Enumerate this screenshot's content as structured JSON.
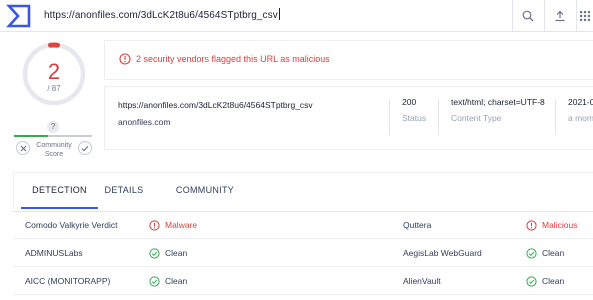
{
  "topbar": {
    "url_value": "https://anonfiles.com/3dLcK2t8u6/4564STptbrg_csv",
    "logo_icon": "virustotal-sigma-logo",
    "search_icon": "search-icon",
    "upload_icon": "upload-icon",
    "apps_icon": "apps-grid-icon"
  },
  "score": {
    "detections": "2",
    "total": "/ 87",
    "community_unknown": "?",
    "community_label": "Community Score"
  },
  "alert": {
    "text": "2 security vendors flagged this URL as malicious",
    "color": "#d93e3e"
  },
  "info": {
    "url": "https://anonfiles.com/3dLcK2t8u6/4564STptbrg_csv",
    "host": "anonfiles.com",
    "status_value": "200",
    "status_label": "Status",
    "content_type_value": "text/html; charset=UTF-8",
    "content_type_label": "Content Type",
    "date_value": "2021-0",
    "date_label": "a mom"
  },
  "tabs": [
    {
      "label": "DETECTION"
    },
    {
      "label": "DETAILS"
    },
    {
      "label": "COMMUNITY"
    }
  ],
  "detections": [
    {
      "vendor_left": "Comodo Valkyrie Verdict",
      "verdict_left": "Malware",
      "vendor_right": "Quttera",
      "verdict_right": "Malicious"
    },
    {
      "vendor_left": "ADMINUSLabs",
      "verdict_left": "Clean",
      "vendor_right": "AegisLab WebGuard",
      "verdict_right": "Clean"
    },
    {
      "vendor_left": "AICC (MONITORAPP)",
      "verdict_left": "Clean",
      "vendor_right": "AlienVault",
      "verdict_right": "Clean"
    }
  ],
  "colors": {
    "accent": "#3a56e4",
    "malicious": "#d93e3e",
    "clean": "#34a853"
  }
}
